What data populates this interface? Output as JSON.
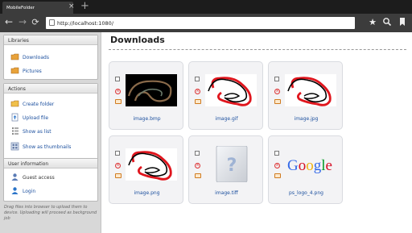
{
  "browser": {
    "tab_title": "MobileFolder",
    "url": "http://localhost:1080/"
  },
  "sidebar": {
    "libraries": {
      "title": "Libraries",
      "items": [
        {
          "label": "Downloads",
          "icon": "folder-icon"
        },
        {
          "label": "Pictures",
          "icon": "folder-icon"
        }
      ]
    },
    "actions": {
      "title": "Actions",
      "items": [
        {
          "label": "Create folder",
          "icon": "create-folder-icon"
        },
        {
          "label": "Upload file",
          "icon": "upload-icon"
        },
        {
          "label": "Show as list",
          "icon": "list-icon"
        },
        {
          "label": "Show as thumbnails",
          "icon": "thumbnails-icon"
        }
      ]
    },
    "user": {
      "title": "User information",
      "items": [
        {
          "label": "Guest access",
          "icon": "user-icon"
        },
        {
          "label": "Login",
          "icon": "login-icon"
        }
      ]
    },
    "drag_note": "Drag files into browser to upload them to device. Uploading will proceed as background job"
  },
  "main": {
    "title": "Downloads",
    "files": [
      {
        "name": "image.bmp",
        "thumb": "bmp-scribble"
      },
      {
        "name": "image.gif",
        "thumb": "scribble"
      },
      {
        "name": "image.jpg",
        "thumb": "scribble"
      },
      {
        "name": "image.png",
        "thumb": "scribble"
      },
      {
        "name": "image.tiff",
        "thumb": "unknown-file"
      },
      {
        "name": "ps_logo_4.png",
        "thumb": "google-logo"
      }
    ],
    "google_logo": {
      "letters": [
        "G",
        "o",
        "o",
        "g",
        "l",
        "e"
      ],
      "colors": [
        "#3369e8",
        "#d50f25",
        "#eeb211",
        "#3369e8",
        "#009925",
        "#d50f25"
      ]
    }
  },
  "colors": {
    "link": "#1b4f9e",
    "chrome_dark": "#3c3c3c",
    "sidebar_bg": "#d8d8d8",
    "scribble_red": "#e0151d"
  }
}
